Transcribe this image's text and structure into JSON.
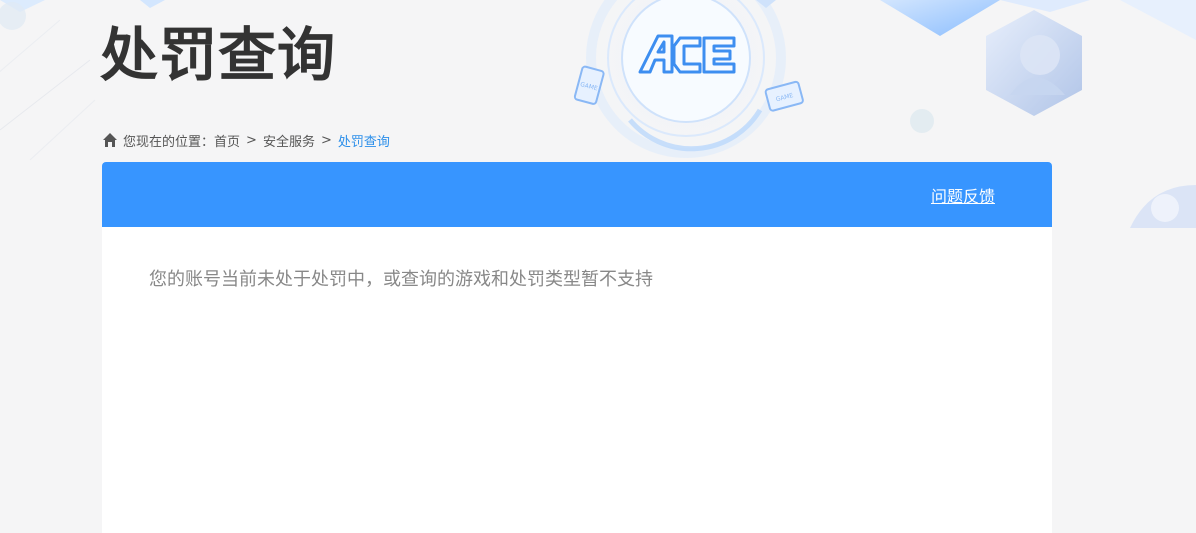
{
  "header": {
    "title": "处罚查询",
    "logo_icon": "ace-logo-icon"
  },
  "breadcrumb": {
    "icon": "home-icon",
    "prefix": "您现在的位置：",
    "items": [
      "首页",
      "安全服务"
    ],
    "separator": ">",
    "current": "处罚查询"
  },
  "panel": {
    "feedback_label": "问题反馈",
    "message": "您的账号当前未处于处罚中，或查询的游戏和处罚类型暂不支持"
  },
  "colors": {
    "accent": "#3795ff",
    "breadcrumb_current": "#2c8fea",
    "title": "#333333",
    "message": "#888888",
    "background": "#f5f5f6"
  }
}
